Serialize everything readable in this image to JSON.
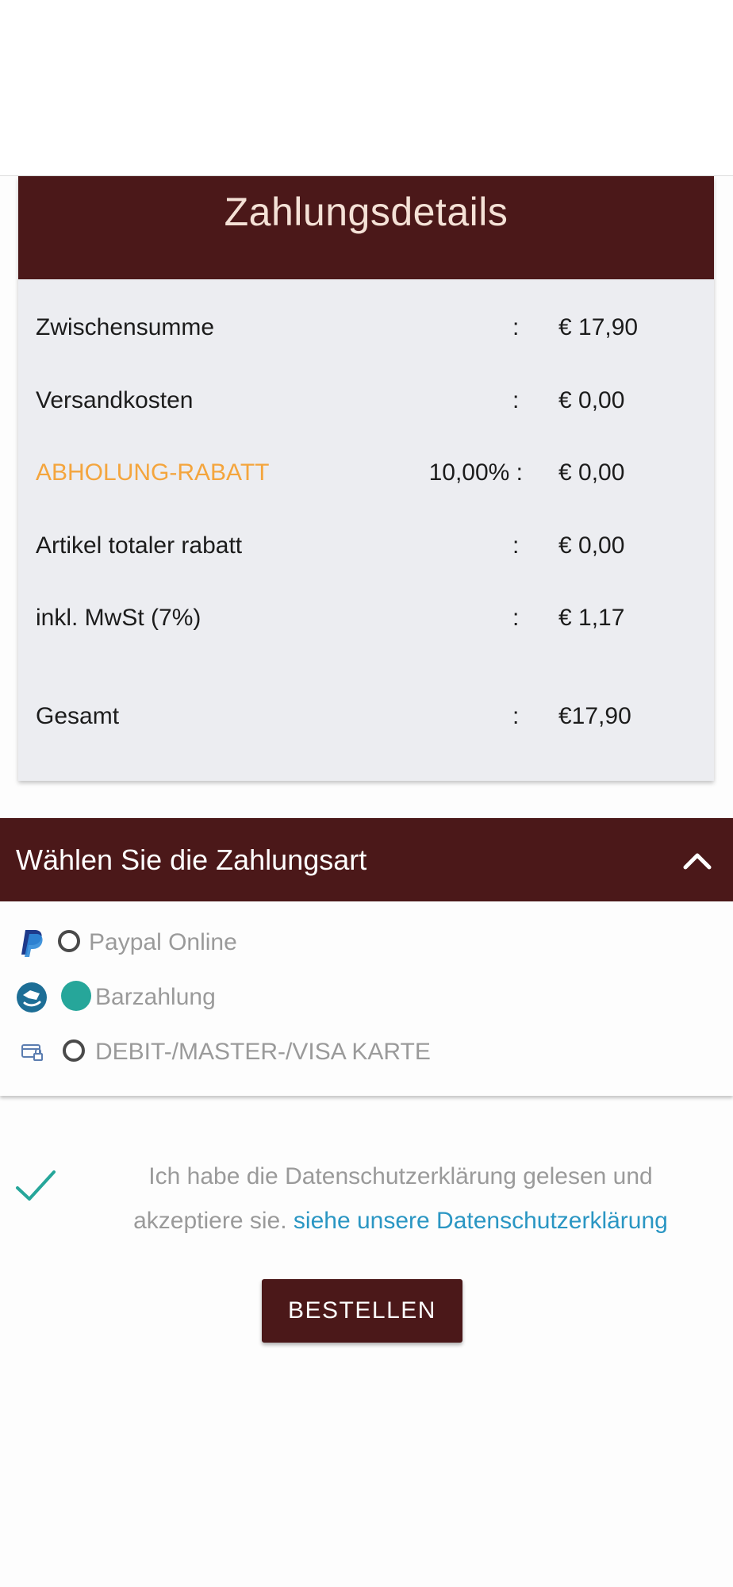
{
  "payment_details": {
    "title": "Zahlungsdetails",
    "rows": [
      {
        "label": "Zwischensumme",
        "percent": "",
        "colon": ":",
        "amount": "€ 17,90"
      },
      {
        "label": "Versandkosten",
        "percent": "",
        "colon": ":",
        "amount": "€ 0,00"
      },
      {
        "label": "ABHOLUNG-RABATT",
        "percent": "10,00% :",
        "colon": "",
        "amount": "€ 0,00"
      },
      {
        "label": "Artikel totaler rabatt",
        "percent": "",
        "colon": ":",
        "amount": "€ 0,00"
      },
      {
        "label": "inkl. MwSt (7%)",
        "percent": "",
        "colon": ":",
        "amount": "€ 1,17"
      },
      {
        "label": "Gesamt",
        "percent": "",
        "colon": ":",
        "amount": "€17,90"
      }
    ]
  },
  "payment_method": {
    "title": "Wählen Sie die Zahlungsart",
    "options": [
      {
        "label": "Paypal Online",
        "icon": "paypal-icon",
        "selected": false
      },
      {
        "label": "Barzahlung",
        "icon": "cash-payment-icon",
        "selected": true
      },
      {
        "label": "DEBIT-/MASTER-/VISA KARTE",
        "icon": "card-icon",
        "selected": false
      }
    ]
  },
  "consent": {
    "text": "Ich habe die Datenschutzerklärung gelesen und akzeptiere sie.",
    "link": "siehe unsere Datenschutzerklärung",
    "checked": true
  },
  "order_button": {
    "label": "BESTELLEN"
  },
  "colors": {
    "header": "#4b1819",
    "discount": "#f4a53d",
    "accent": "#26a69a",
    "link": "#2a96c3"
  }
}
